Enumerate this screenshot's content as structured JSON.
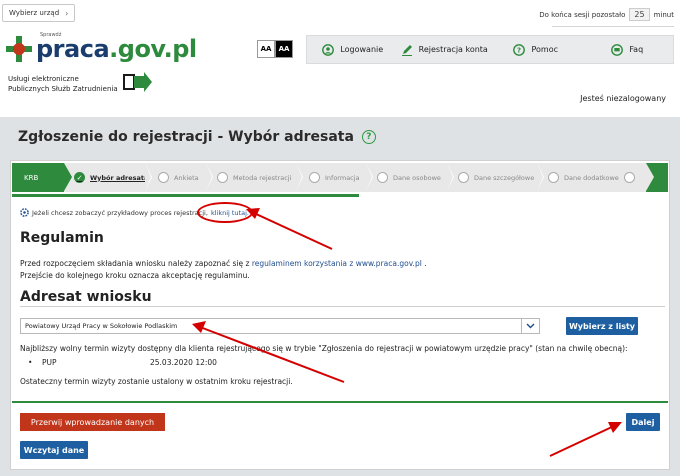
{
  "top": {
    "office_select_label": "Wybierz urząd",
    "session_label": "Do końca sesji pozostało",
    "session_value": "25",
    "session_unit": "minut"
  },
  "logo": {
    "text_main": "praca",
    "text_dot": ".gov.pl",
    "small_text": "Sprawdź"
  },
  "tagline": {
    "line1": "Usługi elektroniczne",
    "line2": "Publicznych Służb Zatrudnienia"
  },
  "contrast": {
    "normal": "AA",
    "high": "AA"
  },
  "nav": {
    "login": "Logowanie",
    "register": "Rejestracja konta",
    "help": "Pomoc",
    "faq": "Faq"
  },
  "login_status": "Jesteś niezalogowany",
  "page_title": "Zgłoszenie do rejestracji - Wybór adresata",
  "stepper": {
    "krb": "KRB",
    "steps": [
      "Wybór adresata",
      "Ankieta",
      "Metoda rejestracji",
      "Informacja",
      "Dane osobowe",
      "Dane szczegółowe",
      "Dane dodatkowe"
    ]
  },
  "info": {
    "text": "Jeżeli chcesz zobaczyć przykładowy proces rejestracji,",
    "link": "kliknij tutaj."
  },
  "regulamin": {
    "heading": "Regulamin",
    "line1_pre": "Przed rozpoczęciem składania wniosku należy zapoznać się z",
    "line1_link": "regulaminem korzystania z www.praca.gov.pl",
    "line1_post": ".",
    "line2": "Przejście do kolejnego kroku oznacza akceptację regulaminu."
  },
  "adresat": {
    "heading": "Adresat wniosku",
    "selected_office": "Powiatowy Urząd Pracy w Sokołowie Podlaskim",
    "choose_button": "Wybierz z listy",
    "term_text": "Najbliższy wolny termin wizyty dostępny dla klienta rejestrującego się w trybie \"Zgłoszenia do rejestracji w powiatowym urzędzie pracy\" (stan na chwilę obecną):",
    "term_office": "PUP",
    "term_date": "25.03.2020 12:00",
    "final_note": "Ostateczny termin wizyty zostanie ustalony w ostatnim kroku rejestracji."
  },
  "buttons": {
    "abort": "Przerwij wprowadzanie danych",
    "load": "Wczytaj dane",
    "next": "Dalej"
  },
  "colors": {
    "green": "#2e8b3e",
    "blue_button": "#1d5fa0",
    "red_button": "#c1361b",
    "annotation_red": "#d40000",
    "page_bg": "#dfe2e4"
  }
}
